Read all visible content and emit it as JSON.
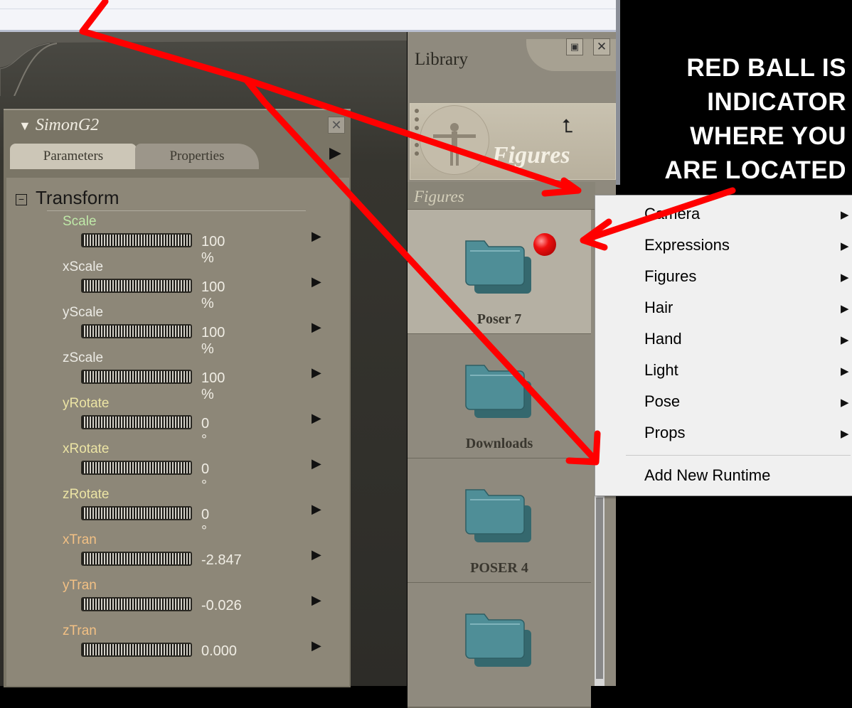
{
  "annotation": {
    "caption_lines": [
      "RED BALL IS",
      "INDICATOR",
      "WHERE YOU",
      "ARE LOCATED"
    ],
    "arrow_color": "#ff0000",
    "indicator_color": "#e01010"
  },
  "parameters_panel": {
    "title": "SimonG2",
    "tabs": [
      "Parameters",
      "Properties"
    ],
    "group_title": "Transform",
    "items": [
      {
        "name": "Scale",
        "value": "100 %",
        "color": "#bfe9a8"
      },
      {
        "name": "xScale",
        "value": "100 %",
        "color": "#ecebe5"
      },
      {
        "name": "yScale",
        "value": "100 %",
        "color": "#ecebe5"
      },
      {
        "name": "zScale",
        "value": "100 %",
        "color": "#ecebe5"
      },
      {
        "name": "yRotate",
        "value": "0 °",
        "color": "#ece4a4"
      },
      {
        "name": "xRotate",
        "value": "0 °",
        "color": "#ece4a4"
      },
      {
        "name": "zRotate",
        "value": "0 °",
        "color": "#ece4a4"
      },
      {
        "name": "xTran",
        "value": "-2.847",
        "color": "#f2c084"
      },
      {
        "name": "yTran",
        "value": "-0.026",
        "color": "#f2c084"
      },
      {
        "name": "zTran",
        "value": "0.000",
        "color": "#f2c084"
      }
    ]
  },
  "library_panel": {
    "title": "Library",
    "category_banner": "Figures",
    "breadcrumb": "Figures",
    "folders": [
      "Poser 7",
      "Downloads",
      "POSER 4",
      ""
    ]
  },
  "context_menu": {
    "items": [
      "Camera",
      "Expressions",
      "Figures",
      "Hair",
      "Hand",
      "Light",
      "Pose",
      "Props"
    ],
    "footer": "Add New Runtime"
  }
}
